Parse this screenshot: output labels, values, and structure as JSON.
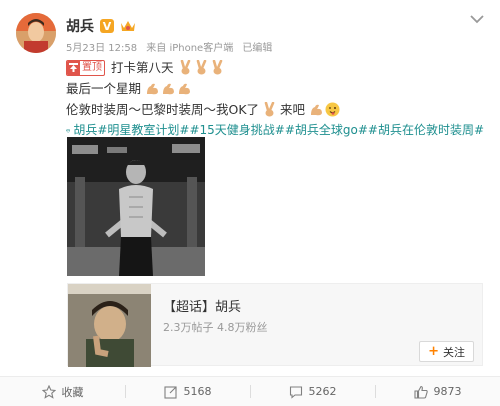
{
  "post": {
    "author": "胡兵",
    "meta": {
      "date": "5月23日 12:58",
      "source": "来自 iPhone客户端",
      "edited": "已编辑"
    },
    "pin_label": "置顶",
    "lines": [
      "打卡第八天",
      "最后一个星期",
      "伦敦时装周～巴黎时装周～我OK了",
      "来吧"
    ],
    "hashtags": "胡兵#明星教室计划##15天健身挑战##胡兵全球go##胡兵在伦敦时装周#"
  },
  "card": {
    "title": "【超话】胡兵",
    "stats": "2.3万帖子  4.8万粉丝",
    "follow_label": "关注"
  },
  "actions": {
    "favorite": "收藏",
    "repost": "5168",
    "comment": "5262",
    "like": "9873"
  },
  "colors": {
    "accent": "#ff8200",
    "tag": "#1e8f8f",
    "pin": "#e0554b",
    "vip": "#f5a623"
  }
}
